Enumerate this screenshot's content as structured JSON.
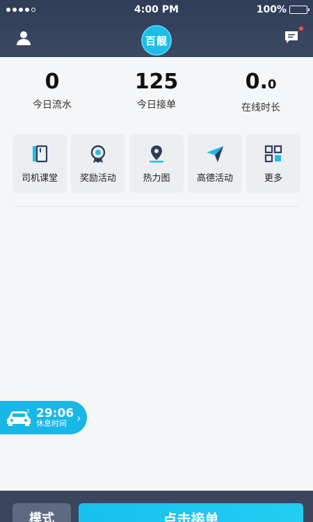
{
  "status_bar": {
    "time": "4:00 PM",
    "battery": "100%"
  },
  "header": {
    "logo_text": "百靓",
    "icons": {
      "profile": "person-icon",
      "message": "message-icon"
    },
    "message_badge_color": "#ff4a4a"
  },
  "stats": [
    {
      "value": "0",
      "label": "今日流水"
    },
    {
      "value": "125",
      "label": "今日接单"
    },
    {
      "value_main": "0.",
      "value_small": "0",
      "label": "在线时长"
    }
  ],
  "shortcuts": [
    {
      "label": "司机课堂",
      "icon": "book-icon"
    },
    {
      "label": "奖励活动",
      "icon": "medal-icon"
    },
    {
      "label": "热力图",
      "icon": "map-pin-icon"
    },
    {
      "label": "高德活动",
      "icon": "paper-plane-icon"
    },
    {
      "label": "更多",
      "icon": "grid-icon"
    }
  ],
  "rest_timer": {
    "time": "29:06",
    "label": "休息时间",
    "icon": "car-icon"
  },
  "bottom_bar": {
    "mode_label": "模式",
    "accept_label": "点击接单"
  },
  "colors": {
    "header_bg": "#2f3d58",
    "accent": "#17b7e6"
  }
}
